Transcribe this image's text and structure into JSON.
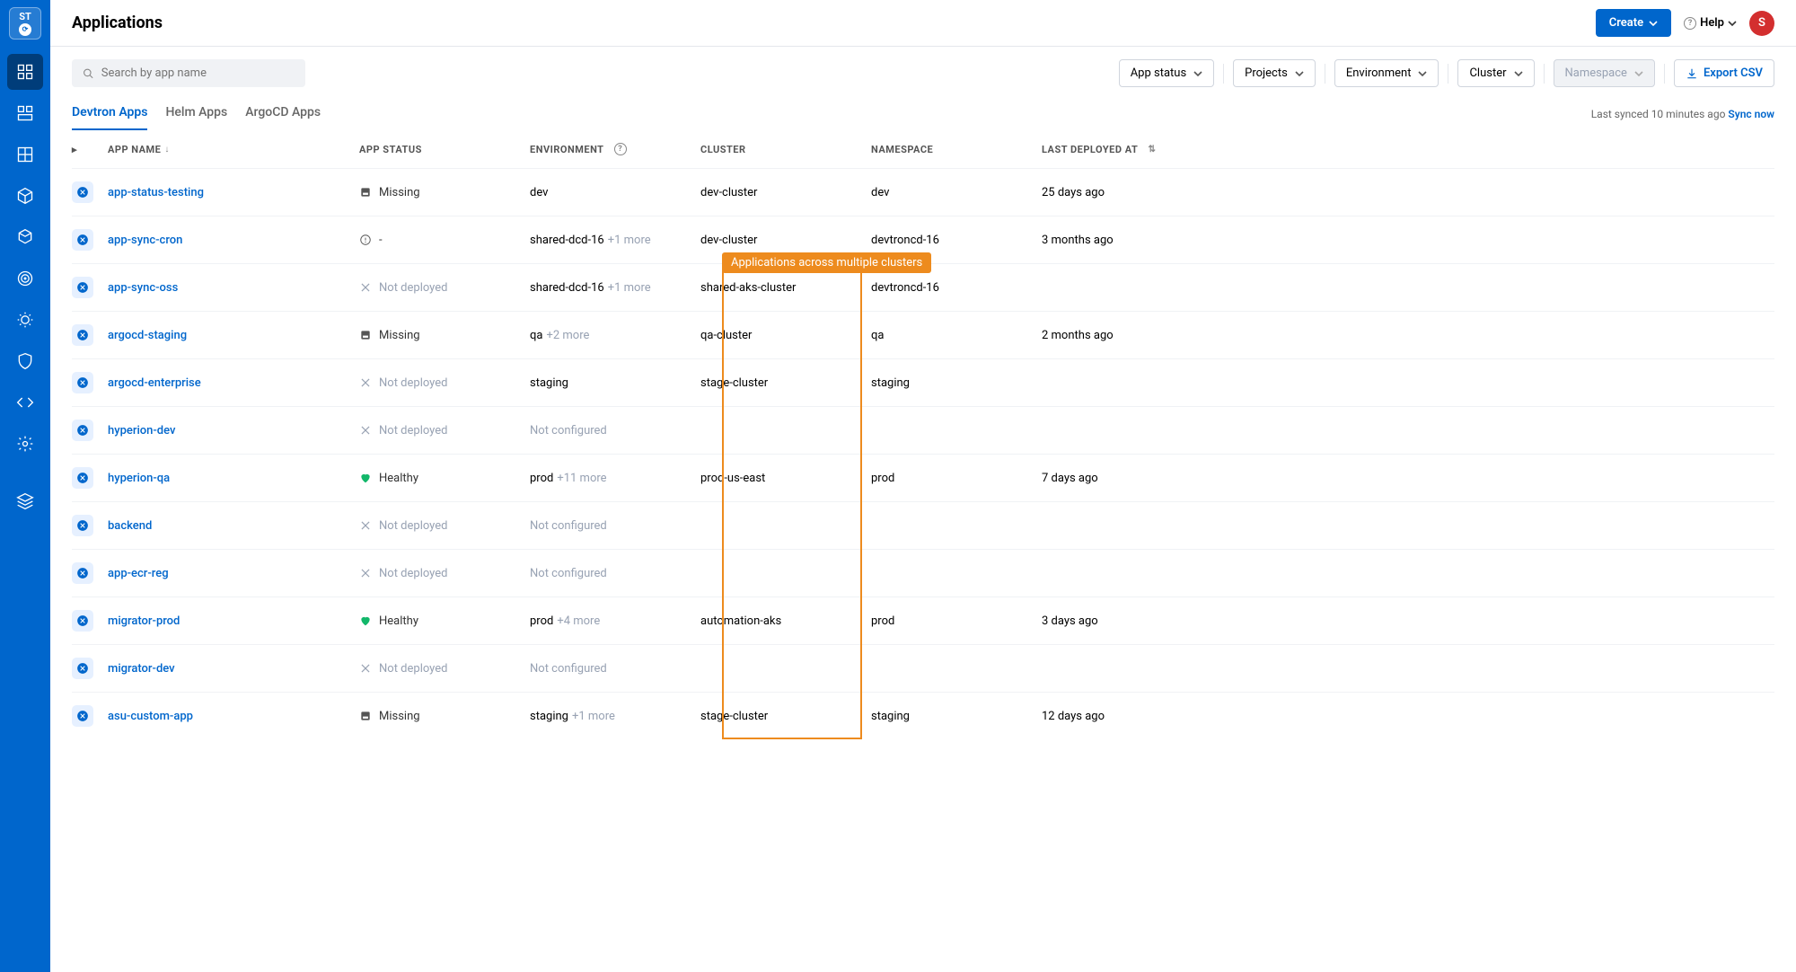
{
  "sidebar": {
    "logo_text": "ST"
  },
  "header": {
    "title": "Applications",
    "create_label": "Create",
    "help_label": "Help",
    "avatar_letter": "S"
  },
  "search": {
    "placeholder": "Search by app name"
  },
  "filters": {
    "app_status": "App status",
    "projects": "Projects",
    "environment": "Environment",
    "cluster": "Cluster",
    "namespace": "Namespace",
    "export": "Export CSV"
  },
  "tabs": {
    "devtron": "Devtron Apps",
    "helm": "Helm Apps",
    "argocd": "ArgoCD Apps"
  },
  "sync": {
    "text": "Last synced 10 minutes ago",
    "link": "Sync now"
  },
  "callout": "Applications across multiple clusters",
  "columns": {
    "app_name": "APP NAME",
    "app_status": "APP STATUS",
    "environment": "ENVIRONMENT",
    "cluster": "CLUSTER",
    "namespace": "NAMESPACE",
    "last_deployed": "LAST DEPLOYED AT"
  },
  "status_labels": {
    "missing": "Missing",
    "dash": "-",
    "not_deployed": "Not deployed",
    "healthy": "Healthy",
    "not_configured": "Not configured"
  },
  "apps": [
    {
      "name": "app-status-testing",
      "status": "missing",
      "env": "dev",
      "env_more": "",
      "cluster": "dev-cluster",
      "namespace": "dev",
      "deployed": "25 days ago"
    },
    {
      "name": "app-sync-cron",
      "status": "dash",
      "env": "shared-dcd-16",
      "env_more": "+1 more",
      "cluster": "dev-cluster",
      "namespace": "devtroncd-16",
      "deployed": "3 months ago"
    },
    {
      "name": "app-sync-oss",
      "status": "not_deployed",
      "env": "shared-dcd-16",
      "env_more": "+1 more",
      "cluster": "shared-aks-cluster",
      "namespace": "devtroncd-16",
      "deployed": ""
    },
    {
      "name": "argocd-staging",
      "status": "missing",
      "env": "qa",
      "env_more": "+2 more",
      "cluster": "qa-cluster",
      "namespace": "qa",
      "deployed": "2 months ago"
    },
    {
      "name": "argocd-enterprise",
      "status": "not_deployed",
      "env": "staging",
      "env_more": "",
      "cluster": "stage-cluster",
      "namespace": "staging",
      "deployed": ""
    },
    {
      "name": "hyperion-dev",
      "status": "not_deployed",
      "env": "not_configured",
      "env_more": "",
      "cluster": "",
      "namespace": "",
      "deployed": ""
    },
    {
      "name": "hyperion-qa",
      "status": "healthy",
      "env": "prod",
      "env_more": "+11 more",
      "cluster": "prod-us-east",
      "namespace": "prod",
      "deployed": "7 days ago"
    },
    {
      "name": "backend",
      "status": "not_deployed",
      "env": "not_configured",
      "env_more": "",
      "cluster": "",
      "namespace": "",
      "deployed": ""
    },
    {
      "name": "app-ecr-reg",
      "status": "not_deployed",
      "env": "not_configured",
      "env_more": "",
      "cluster": "",
      "namespace": "",
      "deployed": ""
    },
    {
      "name": "migrator-prod",
      "status": "healthy",
      "env": "prod",
      "env_more": "+4 more",
      "cluster": "automation-aks",
      "namespace": "prod",
      "deployed": "3 days ago"
    },
    {
      "name": "migrator-dev",
      "status": "not_deployed",
      "env": "not_configured",
      "env_more": "",
      "cluster": "",
      "namespace": "",
      "deployed": ""
    },
    {
      "name": "asu-custom-app",
      "status": "missing",
      "env": "staging",
      "env_more": "+1 more",
      "cluster": "stage-cluster",
      "namespace": "staging",
      "deployed": "12 days ago"
    }
  ]
}
